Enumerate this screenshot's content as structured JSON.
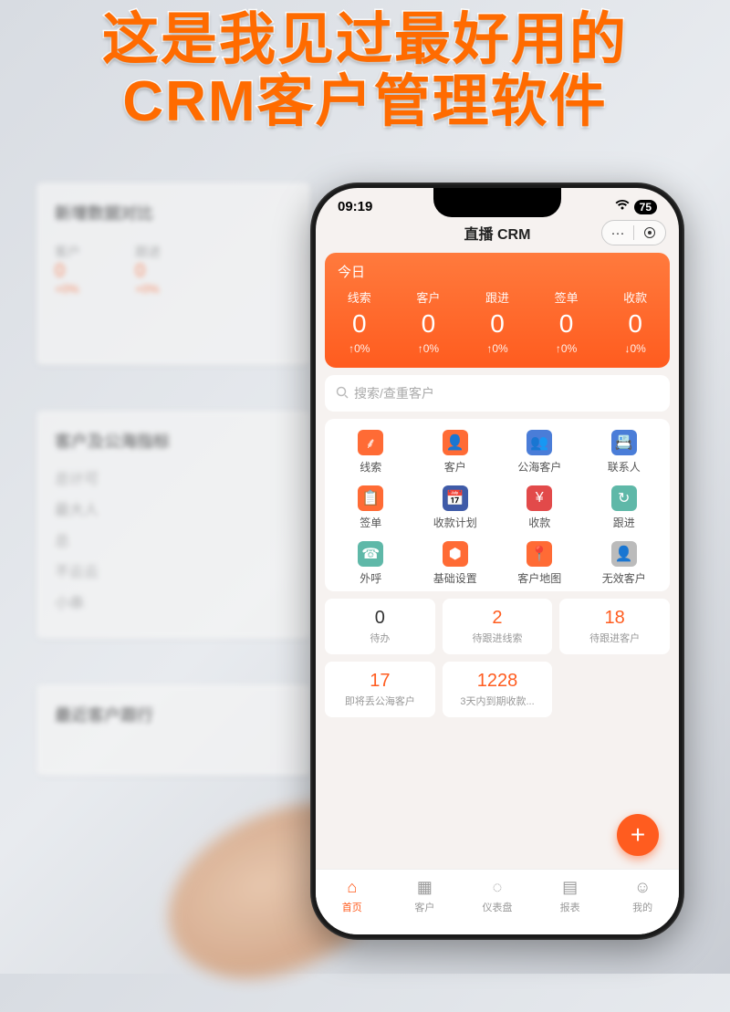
{
  "headline": {
    "line1": "这是我见过最好用的",
    "line2": "CRM客户管理软件"
  },
  "desktop": {
    "card1_title": "新增数据对比",
    "metrics": [
      "客户",
      "跟进"
    ],
    "metric_val": "0",
    "metric_pct": "+0%",
    "card2_title": "客户及公海指标",
    "card2_items": [
      "总计可",
      "最大人",
      "总",
      "不云云",
      "小串"
    ],
    "card3_title": "最近客户跟行"
  },
  "status": {
    "time": "09:19",
    "battery": "75"
  },
  "app_title": "直播 CRM",
  "stats": {
    "today_label": "今日",
    "items": [
      {
        "label": "线索",
        "value": "0",
        "pct": "↑0%"
      },
      {
        "label": "客户",
        "value": "0",
        "pct": "↑0%"
      },
      {
        "label": "跟进",
        "value": "0",
        "pct": "↑0%"
      },
      {
        "label": "签单",
        "value": "0",
        "pct": "↑0%"
      },
      {
        "label": "收款",
        "value": "0",
        "pct": "↓0%"
      }
    ]
  },
  "search_placeholder": "搜索/查重客户",
  "modules": [
    {
      "label": "线索",
      "color": "ic-orange",
      "glyph": "⸙"
    },
    {
      "label": "客户",
      "color": "ic-orange",
      "glyph": "👤"
    },
    {
      "label": "公海客户",
      "color": "ic-blue",
      "glyph": "👥"
    },
    {
      "label": "联系人",
      "color": "ic-blue",
      "glyph": "📇"
    },
    {
      "label": "签单",
      "color": "ic-orange",
      "glyph": "📋"
    },
    {
      "label": "收款计划",
      "color": "ic-navy",
      "glyph": "📅"
    },
    {
      "label": "收款",
      "color": "ic-red",
      "glyph": "¥"
    },
    {
      "label": "跟进",
      "color": "ic-teal",
      "glyph": "↻"
    },
    {
      "label": "外呼",
      "color": "ic-teal",
      "glyph": "☎"
    },
    {
      "label": "基础设置",
      "color": "ic-orange",
      "glyph": "⬢"
    },
    {
      "label": "客户地图",
      "color": "ic-orange",
      "glyph": "📍"
    },
    {
      "label": "无效客户",
      "color": "ic-gray",
      "glyph": "👤"
    }
  ],
  "summary": [
    {
      "num": "0",
      "label": "待办",
      "orange": false
    },
    {
      "num": "2",
      "label": "待跟进线索",
      "orange": true
    },
    {
      "num": "18",
      "label": "待跟进客户",
      "orange": true
    },
    {
      "num": "17",
      "label": "即将丢公海客户",
      "orange": true
    },
    {
      "num": "1228",
      "label": "3天内到期收款...",
      "orange": true
    }
  ],
  "fab": "+",
  "nav": [
    {
      "label": "首页",
      "glyph": "⌂",
      "active": true
    },
    {
      "label": "客户",
      "glyph": "▦",
      "active": false
    },
    {
      "label": "仪表盘",
      "glyph": "◌",
      "active": false
    },
    {
      "label": "报表",
      "glyph": "▤",
      "active": false
    },
    {
      "label": "我的",
      "glyph": "☺",
      "active": false
    }
  ]
}
